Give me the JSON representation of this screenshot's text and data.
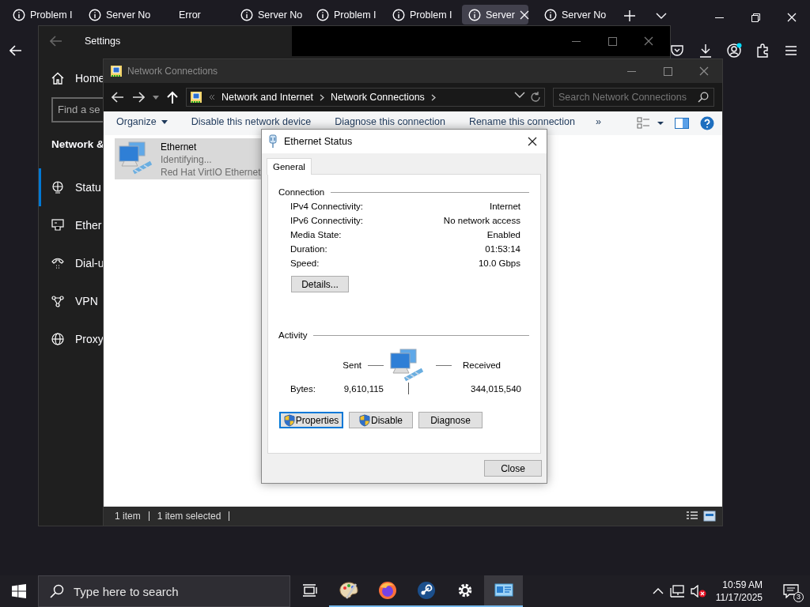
{
  "browser": {
    "tabs": [
      {
        "kind": "info",
        "label": "Problem I",
        "selected": false
      },
      {
        "kind": "info",
        "label": "Server No",
        "selected": false
      },
      {
        "kind": "plain",
        "label": "Error",
        "selected": false
      },
      {
        "kind": "info",
        "label": "Server No",
        "selected": false
      },
      {
        "kind": "info",
        "label": "Problem I",
        "selected": false
      },
      {
        "kind": "info",
        "label": "Problem I",
        "selected": false
      },
      {
        "kind": "info",
        "label": "Server",
        "selected": true
      },
      {
        "kind": "info",
        "label": "Server No",
        "selected": false
      }
    ]
  },
  "settings": {
    "title": "Settings",
    "home": "Home",
    "search": {
      "placeholder": "Find a se"
    },
    "heading": "Network &",
    "nav": [
      {
        "kind": "status",
        "label": "Statu",
        "selected": true
      },
      {
        "kind": "ethernet",
        "label": "Ether",
        "selected": false
      },
      {
        "kind": "dial-up",
        "label": "Dial-u",
        "selected": false
      },
      {
        "kind": "vpn",
        "label": "VPN",
        "selected": false
      },
      {
        "kind": "proxy",
        "label": "Proxy",
        "selected": false
      }
    ]
  },
  "explorer": {
    "title": "Network Connections",
    "breadcrumb": [
      "Network and Internet",
      "Network Connections"
    ],
    "search": {
      "placeholder": "Search Network Connections"
    },
    "commands": [
      {
        "label": "Organize",
        "dropdown": true
      },
      {
        "label": "Disable this network device",
        "dropdown": false
      },
      {
        "label": "Diagnose this connection",
        "dropdown": false
      },
      {
        "label": "Rename this connection",
        "dropdown": false
      }
    ],
    "more": "»",
    "items": [
      {
        "name": "Ethernet",
        "status": "Identifying...",
        "device": "Red Hat VirtIO Ethernet",
        "selected": true
      }
    ],
    "status_bar": [
      "1 item",
      "1 item selected"
    ]
  },
  "dialog": {
    "title": "Ethernet Status",
    "tabs": [
      {
        "label": "General",
        "selected": true
      }
    ],
    "connection": {
      "heading": "Connection",
      "rows": [
        {
          "label": "IPv4 Connectivity:",
          "value": "Internet"
        },
        {
          "label": "IPv6 Connectivity:",
          "value": "No network access"
        },
        {
          "label": "Media State:",
          "value": "Enabled"
        },
        {
          "label": "Duration:",
          "value": "01:53:14"
        },
        {
          "label": "Speed:",
          "value": "10.0 Gbps"
        }
      ],
      "details_button": "Details..."
    },
    "activity": {
      "heading": "Activity",
      "sent_label": "Sent",
      "received_label": "Received",
      "bytes_label": "Bytes:",
      "sent": "9,610,115",
      "received": "344,015,540"
    },
    "buttons": [
      {
        "label": "Properties",
        "shield": true,
        "focused": true
      },
      {
        "label": "Disable",
        "shield": true,
        "focused": false
      },
      {
        "label": "Diagnose",
        "shield": false,
        "focused": false
      }
    ],
    "close_button": "Close"
  },
  "taskbar": {
    "search": {
      "placeholder": "Type here to search"
    },
    "apps": [
      {
        "kind": "task-view",
        "running": false,
        "active": false
      },
      {
        "kind": "paint",
        "running": true,
        "active": false
      },
      {
        "kind": "browser",
        "running": true,
        "active": false
      },
      {
        "kind": "store",
        "running": true,
        "active": false
      },
      {
        "kind": "settings",
        "running": true,
        "active": false
      },
      {
        "kind": "network",
        "running": true,
        "active": true
      }
    ],
    "time": "10:59 AM",
    "date": "11/17/2025",
    "notifications": "3"
  }
}
